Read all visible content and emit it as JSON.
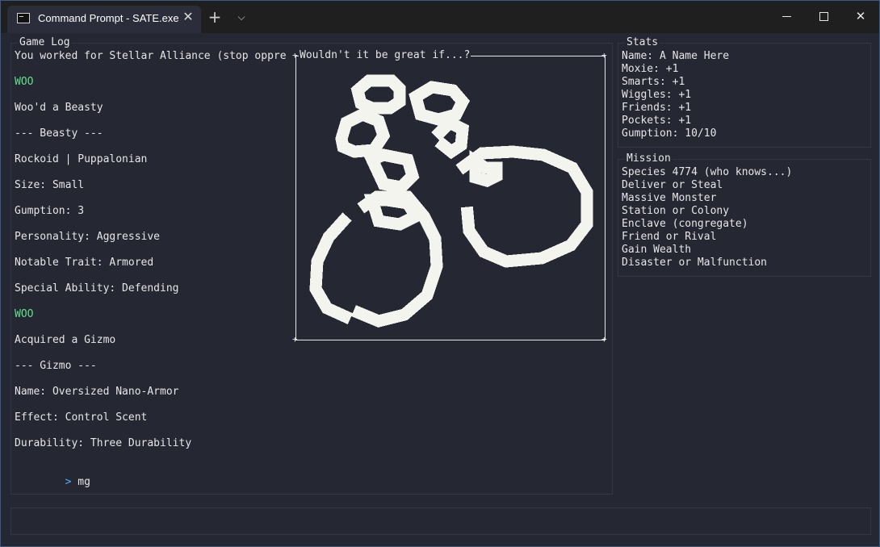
{
  "window": {
    "title": "Command Prompt - SATE.exe",
    "tab_close_glyph": "✕",
    "new_tab_glyph": "+",
    "dropdown_glyph": "⌵",
    "close_glyph": "✕"
  },
  "game_log": {
    "title": "Game Log",
    "lines": [
      "You worked for Stellar Alliance (stop oppre",
      "WOO",
      "Woo'd a Beasty",
      "--- Beasty ---",
      "Rockoid | Puppalonian",
      "Size: Small",
      "Gumption: 3",
      "Personality: Aggressive",
      "Notable Trait: Armored",
      "Special Ability: Defending",
      "WOO",
      "Acquired a Gizmo",
      "--- Gizmo ---",
      "Name: Oversized Nano-Armor",
      "Effect: Control Scent",
      "Durability: Three Durability"
    ],
    "prompt_symbol": ">",
    "prompt_input": "mg"
  },
  "popup": {
    "title": "Wouldn't it be great if...?",
    "image": "handcuffs-pixel-art"
  },
  "stats": {
    "title": "Stats",
    "lines": [
      "Name: A Name Here",
      "Moxie: +1",
      "Smarts: +1",
      "Wiggles: +1",
      "Friends: +1",
      "Pockets: +1",
      "Gumption: 10/10"
    ]
  },
  "mission": {
    "title": "Mission",
    "lines": [
      "Species 4774 (who knows...)",
      "Deliver or Steal",
      "Massive Monster",
      "Station or Colony",
      "Enclave (congregate)",
      "Friend or Rival",
      "Gain Wealth",
      "Disaster or Malfunction"
    ]
  },
  "colors": {
    "background": "#252733",
    "titlebar": "#1f1f1f",
    "text": "#e6e6e6",
    "highlight_green": "#5fe08a",
    "prompt_blue": "#4fb3ff",
    "art": "#f4f4ee"
  }
}
